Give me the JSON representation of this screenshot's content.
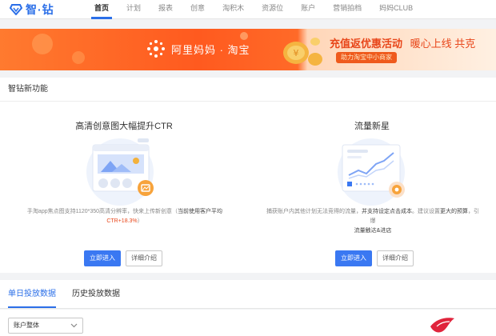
{
  "app": {
    "logo_text": "智·钻"
  },
  "nav": {
    "items": [
      {
        "label": "首页",
        "active": true
      },
      {
        "label": "计划",
        "active": false
      },
      {
        "label": "报表",
        "active": false
      },
      {
        "label": "创意",
        "active": false
      },
      {
        "label": "淘积木",
        "active": false
      },
      {
        "label": "资源位",
        "active": false
      },
      {
        "label": "账户",
        "active": false
      },
      {
        "label": "营销拍档",
        "active": false
      },
      {
        "label": "妈妈CLUB",
        "active": false
      }
    ]
  },
  "banner": {
    "brand": "阿里妈妈 · 淘宝",
    "title": "充值返优惠活动",
    "subtitle": "暖心上线  共克",
    "pill": "助力淘宝中小商家"
  },
  "features": {
    "header": "智钻新功能",
    "left": {
      "title": "高清创意图大幅提升CTR",
      "desc_line1": "手淘app焦点图支持1120*350高清分辨率，快来上传新创意（",
      "desc_hl": "当前使用客户平均",
      "desc_red": "CTR+18.3%",
      "desc_end": "）",
      "primary_btn": "立即进入",
      "secondary_btn": "详细介绍"
    },
    "right": {
      "title": "流量新星",
      "desc_a": "捕获账户内其他计划无法竞得的流量，",
      "desc_hl1": "并支持设定点击成本",
      "desc_b": "。建议设置",
      "desc_hl2": "更大的预算",
      "desc_c": "，引爆",
      "desc_hl3": "流量触达&进店",
      "primary_btn": "立即进入",
      "secondary_btn": "详细介绍"
    }
  },
  "data_tabs": [
    {
      "label": "单日投放数据",
      "active": true
    },
    {
      "label": "历史投放数据",
      "active": false
    }
  ],
  "account_select": {
    "value": "账户整体"
  },
  "colors": {
    "accent": "#2b6fe8",
    "banner": "#ff5a1f",
    "highlight": "#e8461a"
  }
}
